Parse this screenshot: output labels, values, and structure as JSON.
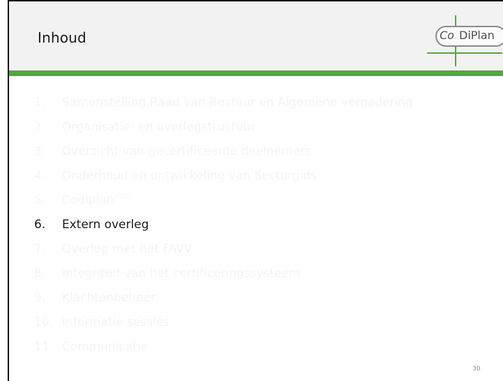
{
  "slide": {
    "title": "Inhoud",
    "logo": {
      "part_co": "Co",
      "part_diplan": "DiPlan"
    },
    "items": [
      {
        "num": "1.",
        "text": "Samenstelling Raad van Bestuur en Algemene vergadering",
        "active": false
      },
      {
        "num": "2.",
        "text": "Organisatie- en overlegstructuur",
        "active": false
      },
      {
        "num": "3.",
        "text": "Overzicht van gecertificeerde deelnemers",
        "active": false
      },
      {
        "num": "4.",
        "text": "Onderhoud en ontwikkeling van Sectorgids",
        "active": false
      },
      {
        "num": "5.",
        "text": "Codiplan",
        "sup": "PLUS",
        "active": false
      },
      {
        "num": "6.",
        "text": "Extern overleg",
        "active": true
      },
      {
        "num": "7.",
        "text": "Overleg met het FAVV",
        "active": false
      },
      {
        "num": "8.",
        "text": "Integriteit van het certificeringssysteem",
        "active": false
      },
      {
        "num": "9.",
        "text": "Klachtenbeheer",
        "active": false
      },
      {
        "num": "10.",
        "text": "Informatie sessies",
        "active": false
      },
      {
        "num": "11.",
        "text": "Communicatie",
        "active": false
      }
    ],
    "page_number": "30",
    "colors": {
      "accent_green": "#57a63c",
      "header_bg": "#f2f2f2",
      "inactive_text": "#f4f4f4",
      "active_text": "#1a1a1a"
    }
  }
}
